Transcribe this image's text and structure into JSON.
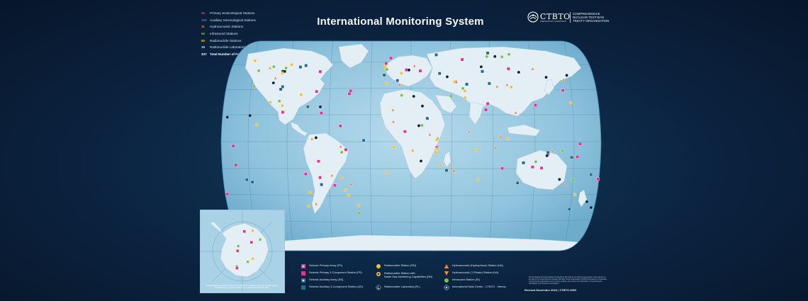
{
  "title": "International Monitoring System",
  "logo": {
    "brand": "CTBTO",
    "brand_sub": "PREPARATORY COMMISSION",
    "org_line1": "COMPREHENSIVE",
    "org_line2": "NUCLEAR-TEST-BAN",
    "org_line3": "TREATY ORGANIZATION"
  },
  "counts": [
    {
      "num": "50",
      "label": "Primary Seismological Stations",
      "color": "#e8318a"
    },
    {
      "num": "120",
      "label": "Auxiliary Seismological Stations",
      "color": "#3a86c8"
    },
    {
      "num": "11",
      "label": "Hydroacoustic Stations",
      "color": "#f08a2c"
    },
    {
      "num": "60",
      "label": "Infrasound Stations",
      "color": "#79c142"
    },
    {
      "num": "80",
      "label": "Radionuclide Stations",
      "color": "#f2c12e"
    },
    {
      "num": "16",
      "label": "Radionuclide Laboratories",
      "color": "#cfe0ef"
    },
    {
      "num": "337",
      "label": "Total Number of Facilities",
      "color": "#ffffff"
    }
  ],
  "legend": [
    {
      "label": "Seismic Primary Array (PS)",
      "icon": "pink-square-dot-icon"
    },
    {
      "label": "Seismic Primary 3-Component Station (PS)",
      "icon": "pink-square-icon"
    },
    {
      "label": "Seismic Auxiliary Array (AS)",
      "icon": "teal-square-dot-icon"
    },
    {
      "label": "Seismic Auxiliary 3-Component Station (AS)",
      "icon": "teal-square-icon"
    },
    {
      "label": "Radionuclide Station (RN)",
      "icon": "yellow-circle-icon"
    },
    {
      "label": "Radionuclide Station with",
      "label2": "Noble Gas Monitoring Capabilities (RN)",
      "icon": "yellow-ring-icon"
    },
    {
      "label": "Radionuclide Laboratory (RL)",
      "icon": "lab-icon"
    },
    {
      "label": "Hydroacoustic (Hydrophone) Station (HA)",
      "icon": "orange-triangle-icon"
    },
    {
      "label": "Hydroacoustic (T-Phase) Station (HA)",
      "icon": "orange-triangle-down-icon"
    },
    {
      "label": "Infrasound Station (IS)",
      "icon": "green-circle-icon"
    },
    {
      "label": "International Data Centre - CTBTO - Vienna",
      "icon": "idc-icon"
    }
  ],
  "disclaimer": "The boundaries and presentation of material on this map do not imply the expression of any opinion on the part of the Comprehensive Nuclear-Test-Ban Treaty Organization (CTBTO) Preparatory Commission concerning the legal status of any country, territory, city or area or its authorities, or concerning the delimitation of its frontiers or boundaries.",
  "inset_note": "The designations employed and the presentation of material on this map do not imply the expression of any opinion whatsoever on the part of the Secretariat",
  "revised": "Revised November 2024",
  "website": "CTBTO.ORG",
  "colors": {
    "ocean": "#8fc3dd",
    "land": "#e3eef5",
    "background": "#0b2340",
    "ps": "#e8318a",
    "as": "#1f6b8c",
    "rn": "#f2c12e",
    "ha": "#f08a2c",
    "is": "#79c142",
    "rl": "#0b1f36"
  }
}
